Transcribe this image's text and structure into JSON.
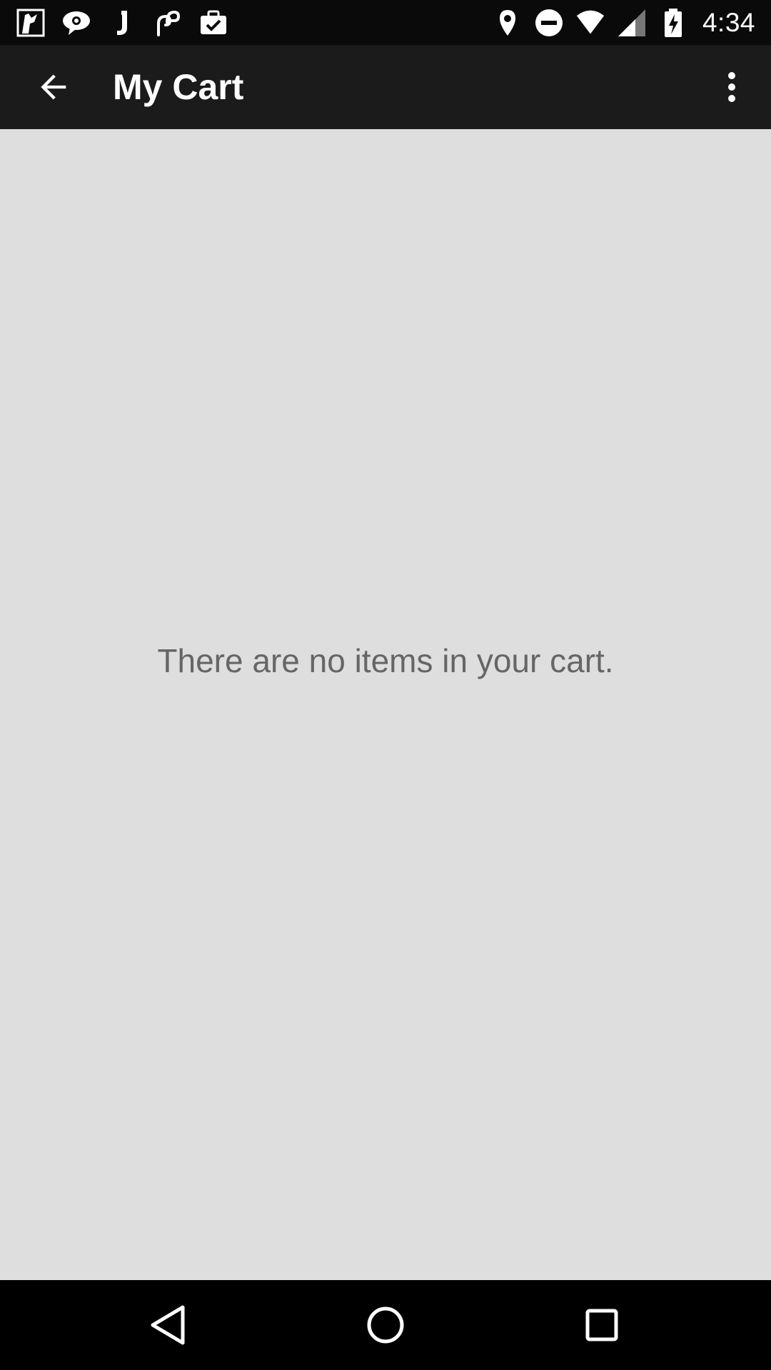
{
  "status_bar": {
    "time": "4:34",
    "left_icons": [
      "photo-notification-icon",
      "chat-notification-icon",
      "j-app-notification-icon",
      "link-notification-icon",
      "briefcase-notification-icon"
    ],
    "right_icons": [
      "location-icon",
      "do-not-disturb-icon",
      "wifi-icon",
      "cell-signal-icon",
      "battery-charging-icon"
    ]
  },
  "app_bar": {
    "back_icon": "arrow-back-icon",
    "title": "My Cart",
    "overflow_icon": "more-vert-icon"
  },
  "content": {
    "empty_message": "There are no items in your cart."
  },
  "nav_bar": {
    "back_icon": "nav-back-icon",
    "home_icon": "nav-home-icon",
    "recents_icon": "nav-recents-icon"
  },
  "colors": {
    "status_bar_bg": "#0a0a0a",
    "app_bar_bg": "#1b1b1b",
    "content_bg": "#dedede",
    "empty_text": "#666666",
    "nav_bar_bg": "#000000"
  }
}
